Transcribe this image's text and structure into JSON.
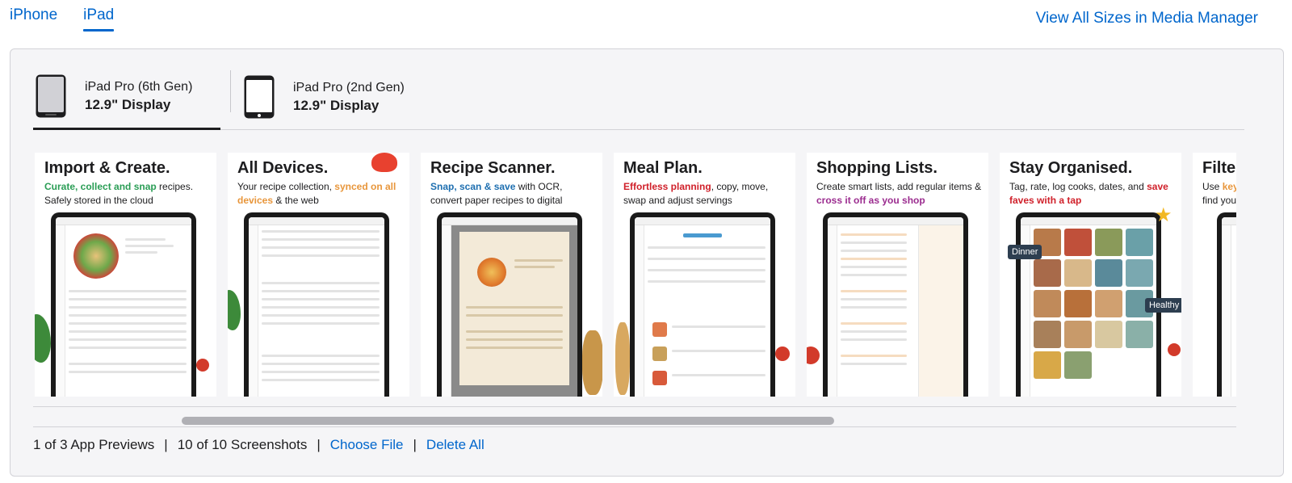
{
  "top_tabs": [
    {
      "label": "iPhone",
      "active": false
    },
    {
      "label": "iPad",
      "active": true
    }
  ],
  "media_manager_link": "View All Sizes in Media Manager",
  "device_tabs": [
    {
      "name": "iPad Pro (6th Gen)",
      "size": "12.9\" Display",
      "active": true
    },
    {
      "name": "iPad Pro (2nd Gen)",
      "size": "12.9\" Display",
      "active": false
    }
  ],
  "screenshots": [
    {
      "headline": "Import & Create.",
      "sub_parts": [
        {
          "text": "Curate, collect and snap",
          "style": "hl-green"
        },
        {
          "text": " recipes. Safely stored in the cloud",
          "style": ""
        }
      ]
    },
    {
      "headline": "All Devices.",
      "sub_parts": [
        {
          "text": "Your recipe collection, ",
          "style": ""
        },
        {
          "text": "synced on all devices",
          "style": "hl-orange"
        },
        {
          "text": " & the web",
          "style": ""
        }
      ]
    },
    {
      "headline": "Recipe Scanner.",
      "sub_parts": [
        {
          "text": "Snap, scan & save",
          "style": "hl-blue"
        },
        {
          "text": " with OCR, convert paper recipes to digital",
          "style": ""
        }
      ]
    },
    {
      "headline": "Meal Plan.",
      "sub_parts": [
        {
          "text": "Effortless planning",
          "style": "hl-red"
        },
        {
          "text": ", copy, move, swap and adjust servings",
          "style": ""
        }
      ]
    },
    {
      "headline": "Shopping Lists.",
      "sub_parts": [
        {
          "text": "Create smart lists, add regular items & ",
          "style": ""
        },
        {
          "text": "cross it off as you shop",
          "style": "hl-purple"
        }
      ]
    },
    {
      "headline": "Stay Organised.",
      "sub_parts": [
        {
          "text": "Tag, rate, log cooks, dates, and ",
          "style": ""
        },
        {
          "text": "save faves with a tap",
          "style": "hl-red"
        }
      ],
      "tags": [
        "Dinner",
        "Healthy"
      ]
    },
    {
      "headline": "Filte",
      "sub_parts": [
        {
          "text": "Use ",
          "style": ""
        },
        {
          "text": "key",
          "style": "hl-orange"
        },
        {
          "text": " find your",
          "style": ""
        }
      ]
    }
  ],
  "footer": {
    "app_previews": "1 of 3 App Previews",
    "screenshots": "10 of 10 Screenshots",
    "choose_file": "Choose File",
    "delete_all": "Delete All",
    "separator": "|"
  },
  "colors": {
    "link": "#0066cc",
    "panel_bg": "#f5f5f7",
    "scroll_thumb": "#b0b0b5"
  }
}
